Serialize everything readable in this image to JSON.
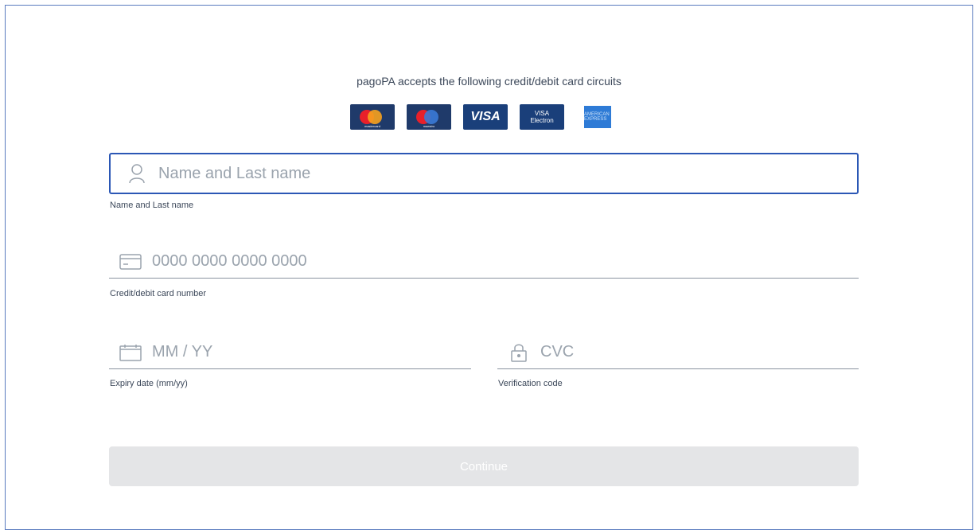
{
  "header": {
    "title": "pagoPA accepts the following credit/debit card circuits"
  },
  "card_circuits": [
    {
      "name": "Mastercard",
      "icon": "mastercard-logo",
      "label": "mastercard"
    },
    {
      "name": "Maestro",
      "icon": "maestro-logo",
      "label": "maestro"
    },
    {
      "name": "VISA",
      "icon": "visa-logo",
      "label": "VISA"
    },
    {
      "name": "Visa Electron",
      "icon": "visa-electron-logo",
      "label_top": "VISA",
      "label_bottom": "Electron"
    },
    {
      "name": "American Express",
      "icon": "amex-logo",
      "label": "AMERICAN EXPRESS"
    }
  ],
  "form": {
    "name": {
      "placeholder": "Name and Last name",
      "value": "",
      "helper": "Name and Last name",
      "icon": "user-icon"
    },
    "card_number": {
      "placeholder": "0000 0000 0000 0000",
      "value": "",
      "helper": "Credit/debit card number",
      "icon": "credit-card-icon"
    },
    "expiry": {
      "placeholder": "MM / YY",
      "value": "",
      "helper": "Expiry date (mm/yy)",
      "icon": "calendar-icon"
    },
    "cvc": {
      "placeholder": "CVC",
      "value": "",
      "helper": "Verification code",
      "icon": "lock-icon"
    }
  },
  "actions": {
    "continue_label": "Continue",
    "continue_enabled": false
  },
  "colors": {
    "focus_border": "#2b57b5",
    "text": "#3b4759",
    "placeholder": "#9aa3ad",
    "button_disabled_bg": "#e4e5e7",
    "frame_border": "#5a7bbf"
  }
}
